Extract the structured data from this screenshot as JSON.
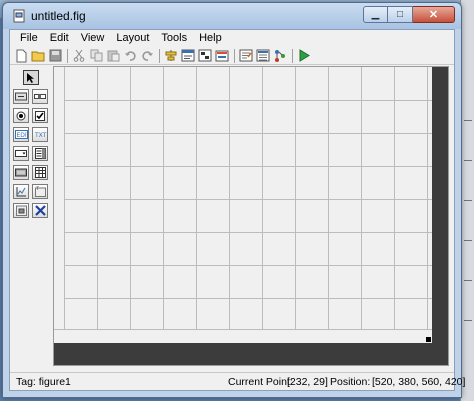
{
  "window": {
    "title": "untitled.fig"
  },
  "menu": [
    "File",
    "Edit",
    "View",
    "Layout",
    "Tools",
    "Help"
  ],
  "toolbar": {
    "groups": [
      [
        "new-file-icon",
        "open-folder-icon",
        "save-icon"
      ],
      [
        "cut-icon",
        "copy-icon",
        "paste-icon",
        "undo-icon",
        "redo-icon"
      ],
      [
        "align-objects-icon",
        "menu-editor-icon",
        "tab-order-icon",
        "toolbar-editor-icon"
      ],
      [
        "m-file-editor-icon",
        "property-inspector-icon",
        "object-browser-icon"
      ],
      [
        "run-figure-icon"
      ]
    ]
  },
  "palette": [
    "select-arrow-icon",
    "push-button-icon",
    "slider-icon",
    "radio-button-icon",
    "check-box-icon",
    "edit-text-icon",
    "static-text-icon",
    "popup-menu-icon",
    "listbox-icon",
    "toggle-button-icon",
    "table-icon",
    "axes-icon",
    "panel-icon",
    "button-group-icon",
    "activex-control-icon"
  ],
  "status": {
    "tag": "Tag: figure1",
    "current_point_label": "Current Point:",
    "current_point_value": "[232, 29]",
    "position_label": "Position:",
    "position_value": "[520, 380, 560, 420]"
  }
}
